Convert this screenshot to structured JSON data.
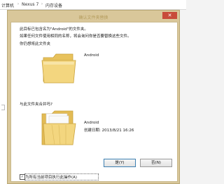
{
  "breadcrumb": {
    "items": [
      "计算机",
      "Nexus 7",
      "内存设备"
    ],
    "separator": "›"
  },
  "dialog": {
    "title": "确认文件夹替换",
    "close_symbol": "✕",
    "message1": "此目标已包含名为\"Android\"的文件夹。",
    "message2": "如果任何文件使用相同的名称，将会询问你是否要替换这些文件。",
    "question1": "你仍想将此文件夹",
    "source_name": "Android",
    "question2": "与此文件夹合并吗?",
    "dest_name": "Android",
    "dest_created": "创建日期: 2013/8/21 16:26",
    "yes_label": "是(Y)",
    "no_label": "否(N)",
    "checkbox_label": "为所有当前项目执行此操作(A)",
    "checkbox_checked": true,
    "checkbox_mark": "✓"
  },
  "colors": {
    "dialog_frame": "#d9c79a",
    "close_button": "#c84b3a",
    "folder": "#f0d27a"
  }
}
